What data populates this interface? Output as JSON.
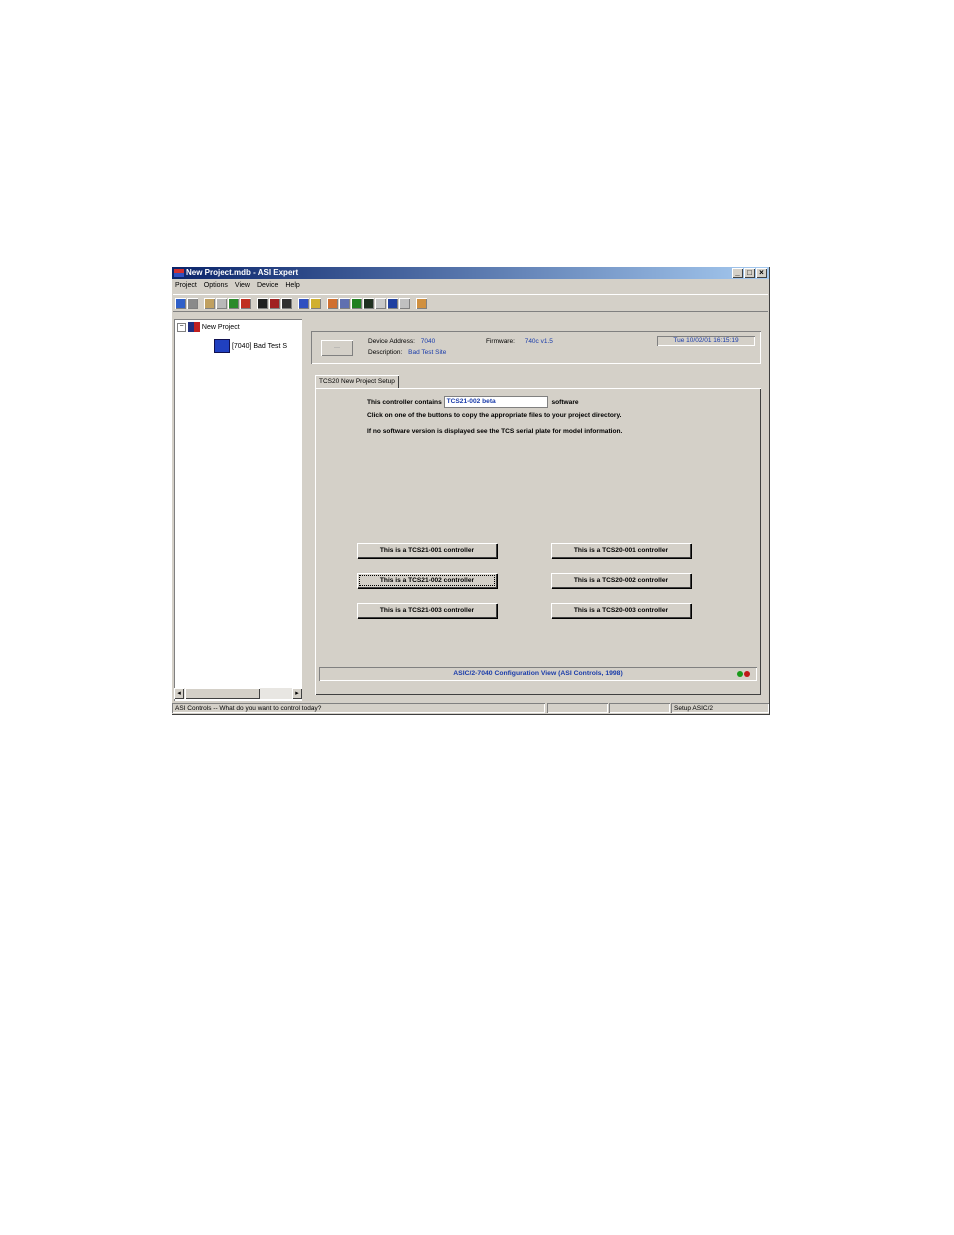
{
  "window": {
    "title": "New Project.mdb - ASI Expert"
  },
  "window_buttons": [
    "_",
    "□",
    "×"
  ],
  "menu": [
    "Project",
    "Options",
    "View",
    "Device",
    "Help"
  ],
  "tree": {
    "root": "New Project",
    "child": "[7040] Bad Test S"
  },
  "header": {
    "device_address_label": "Device Address:",
    "device_address": "7040",
    "firmware_label": "Firmware:",
    "firmware": "740c v1.5",
    "description_label": "Description:",
    "description": "Bad Test Site",
    "datetime": "Tue 10/02/01 16:15:19"
  },
  "tab": {
    "label": "TCS20 New Project Setup"
  },
  "panel": {
    "line1_prefix": "This controller contains",
    "software_version": "TCS21-002 beta",
    "line1_suffix": "software",
    "line2": "Click on one of the buttons to copy the appropriate files to your project directory.",
    "line3": "If no software version is displayed see the TCS serial plate for model information."
  },
  "buttons": {
    "tcs21_001": "This is a TCS21-001 controller",
    "tcs21_002": "This is a TCS21-002 controller",
    "tcs21_003": "This is a TCS21-003 controller",
    "tcs20_001": "This is a TCS20-001 controller",
    "tcs20_002": "This is a TCS20-002 controller",
    "tcs20_003": "This is a TCS20-003 controller"
  },
  "footer": {
    "label": "ASIC/2-7040 Configuration View (ASI Controls, 1998)"
  },
  "status": {
    "message": "ASI Controls -- What do you want to control today?",
    "right": "Setup ASIC/2"
  },
  "colors": {
    "title_start": "#0a246a",
    "title_end": "#a6caf0",
    "light_green": "#1a9a1a",
    "light_red": "#c01818"
  }
}
